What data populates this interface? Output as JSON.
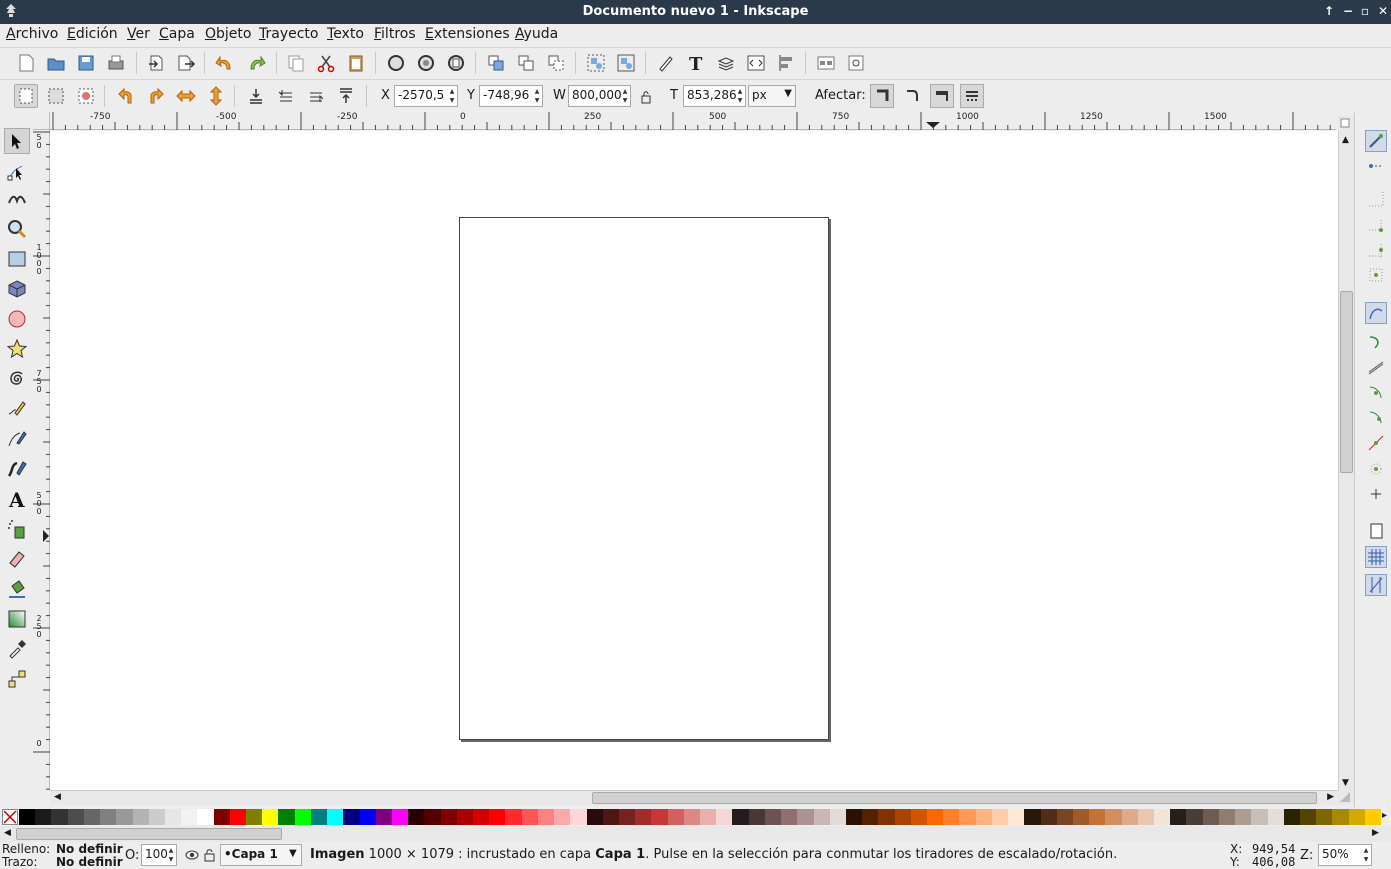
{
  "window": {
    "title": "Documento nuevo 1 - Inkscape",
    "controls": [
      "↑",
      "−",
      "▫",
      "✕"
    ]
  },
  "menu": [
    "Archivo",
    "Edición",
    "Ver",
    "Capa",
    "Objeto",
    "Trayecto",
    "Texto",
    "Filtros",
    "Extensiones",
    "Ayuda"
  ],
  "selector_toolbar": {
    "x_label": "X",
    "x_value": "-2570,5",
    "y_label": "Y",
    "y_value": "-748,96",
    "w_label": "W",
    "w_value": "800,000",
    "h_label": "T",
    "h_value": "853,286",
    "unit": "px",
    "affect_label": "Afectar:"
  },
  "ruler_top": [
    "-750",
    "-500",
    "-250",
    "0",
    "250",
    "500",
    "750",
    "1000",
    "1250",
    "1500"
  ],
  "ruler_left": [
    {
      "digits": "5 0"
    },
    {
      "digits": "1 0 0 0"
    },
    {
      "digits": "7 5 0"
    },
    {
      "digits": "5 0 0"
    },
    {
      "digits": "2 5 0"
    },
    {
      "digits": "0"
    }
  ],
  "palette": {
    "colors": [
      "#000000",
      "#1a1a1a",
      "#333333",
      "#4d4d4d",
      "#666666",
      "#808080",
      "#999999",
      "#b3b3b3",
      "#cccccc",
      "#e6e6e6",
      "#f2f2f2",
      "#ffffff",
      "#800000",
      "#ff0000",
      "#808000",
      "#ffff00",
      "#008000",
      "#00ff00",
      "#008080",
      "#00ffff",
      "#000080",
      "#0000ff",
      "#800080",
      "#ff00ff",
      "#2b0000",
      "#550000",
      "#800000",
      "#aa0000",
      "#d40000",
      "#ff0000",
      "#ff2a2a",
      "#ff5555",
      "#ff8080",
      "#ffaaaa",
      "#ffd5d5",
      "#280b0b",
      "#501616",
      "#782121",
      "#a02c2c",
      "#c83737",
      "#d35f5f",
      "#de8787",
      "#e9afaf",
      "#f4d7d7",
      "#241c1c",
      "#483737",
      "#6c5353",
      "#916f6f",
      "#ac9393",
      "#c8b7b7",
      "#e3dbdb",
      "#2b1100",
      "#552200",
      "#803300",
      "#aa4400",
      "#d45500",
      "#ff6600",
      "#ff7f2a",
      "#ff9955",
      "#ffb380",
      "#ffccaa",
      "#ffe6d5",
      "#28170b",
      "#502d16",
      "#784421",
      "#a05a2c",
      "#c87137",
      "#d38d5f",
      "#deaa87",
      "#e9c6af",
      "#f4e3d7",
      "#241f1c",
      "#483e37",
      "#6c5d53",
      "#917c6f",
      "#ac9d93",
      "#c8beb7",
      "#e3dedb",
      "#2b2200",
      "#554400",
      "#806600",
      "#aa8800",
      "#d4aa00",
      "#ffcc00"
    ]
  },
  "status": {
    "fill_label": "Relleno:",
    "fill_value": "No definir",
    "stroke_label": "Trazo:",
    "stroke_value": "No definir",
    "opacity_label": "O:",
    "opacity_value": "100",
    "layer": "•Capa 1",
    "message_strong": "Imagen",
    "message_part1": " 1000 × 1079 : incrustado en capa ",
    "message_layer": "Capa 1",
    "message_part2": ". Pulse en la selección para conmutar los tiradores de escalado/rotación.",
    "x_label": "X:",
    "x_coord": "949,54",
    "y_label": "Y:",
    "y_coord": "406,08",
    "zoom_label": "Z:",
    "zoom": "50%"
  }
}
